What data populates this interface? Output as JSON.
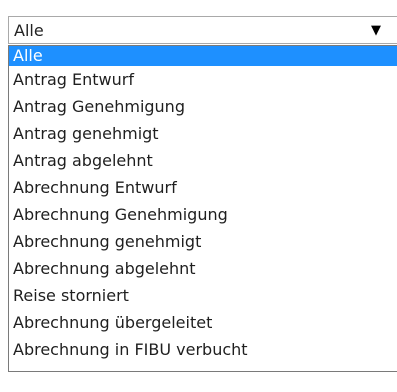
{
  "select": {
    "value": "Alle",
    "arrow_icon": "dropdown-triangle-icon",
    "options": [
      "Alle",
      "Antrag Entwurf",
      "Antrag Genehmigung",
      "Antrag genehmigt",
      "Antrag abgelehnt",
      "Abrechnung Entwurf",
      "Abrechnung Genehmigung",
      "Abrechnung genehmigt",
      "Abrechnung abgelehnt",
      "Reise storniert",
      "Abrechnung übergeleitet",
      "Abrechnung in FIBU verbucht"
    ],
    "selected_index": 0
  },
  "colors": {
    "selected_bg": "#1e90ff",
    "selected_text": "#ffffff",
    "text": "#1f1f1f",
    "border": "#a9a9a9"
  }
}
